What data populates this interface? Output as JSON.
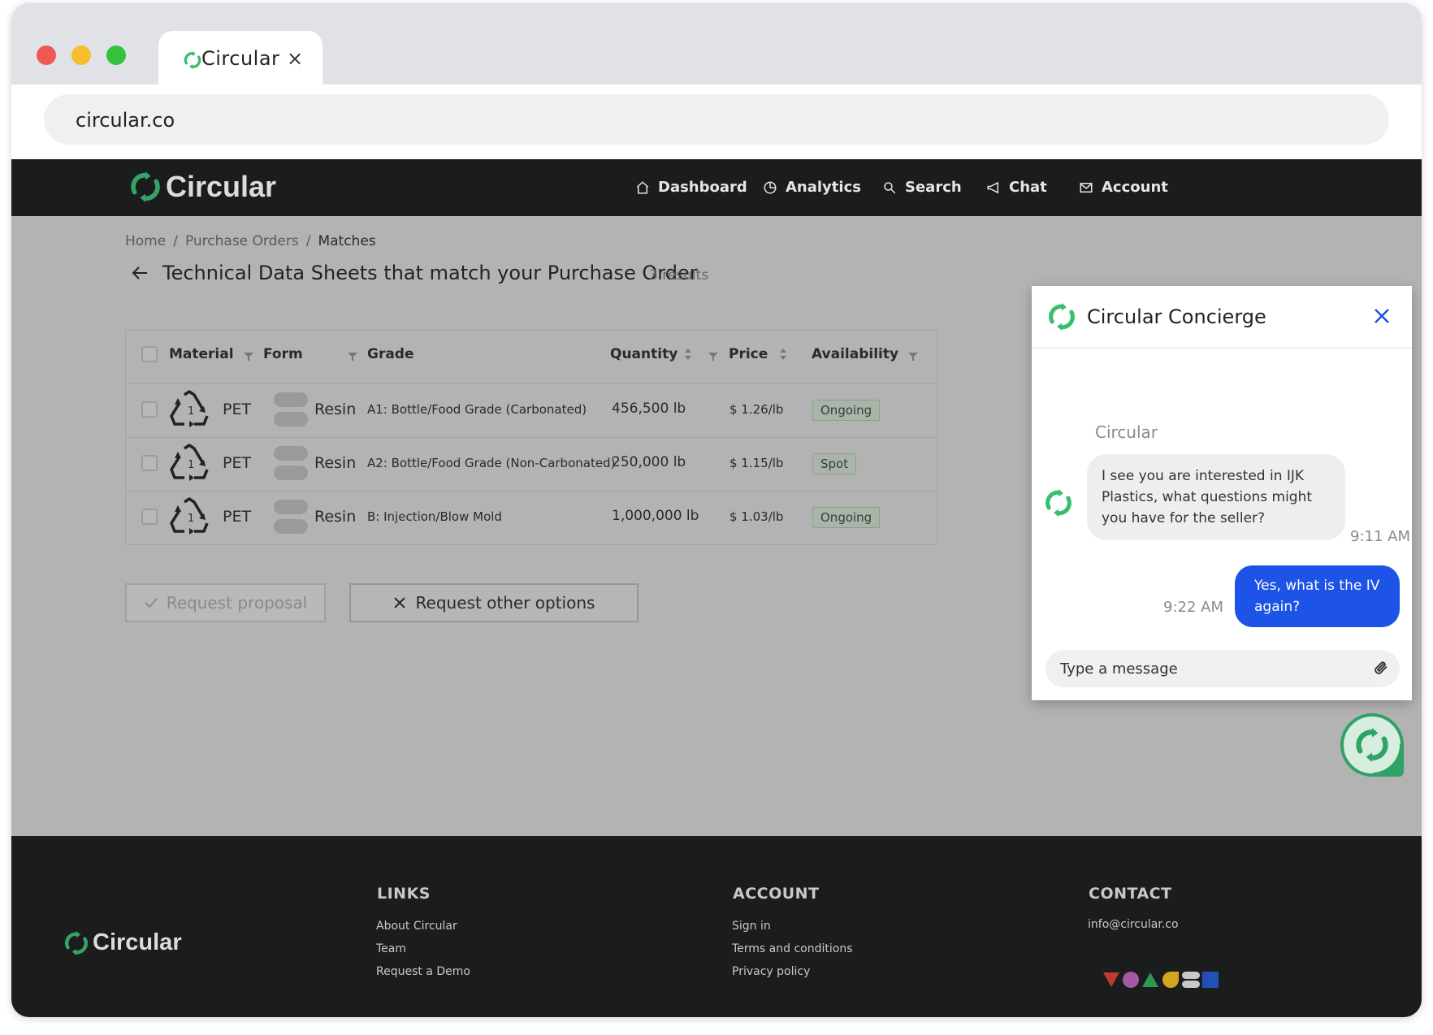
{
  "browser": {
    "tab_title": "Circular",
    "tab_close": "×",
    "url": "circular.co"
  },
  "header": {
    "brand": "Circular",
    "nav": [
      {
        "label": "Dashboard",
        "icon": "home-icon"
      },
      {
        "label": "Analytics",
        "icon": "pie-chart-icon"
      },
      {
        "label": "Search",
        "icon": "search-icon"
      },
      {
        "label": "Chat",
        "icon": "megaphone-icon"
      },
      {
        "label": "Account",
        "icon": "mail-icon"
      }
    ]
  },
  "breadcrumb": {
    "home": "Home",
    "sep": "/",
    "purchase_orders": "Purchase Orders",
    "current": "Matches"
  },
  "main": {
    "title": "Technical Data Sheets that match your Purchase Order",
    "results": "3 results"
  },
  "table": {
    "headers": {
      "material": "Material",
      "form": "Form",
      "grade": "Grade",
      "quantity": "Quantity",
      "price": "Price",
      "availability": "Availability"
    },
    "rows": [
      {
        "material_code": "1",
        "material": "PET",
        "form": "Resin",
        "grade": "A1: Bottle/Food Grade (Carbonated)",
        "quantity": "456,500 lb",
        "price": "$ 1.26/lb",
        "availability": "Ongoing"
      },
      {
        "material_code": "1",
        "material": "PET",
        "form": "Resin",
        "grade": "A2: Bottle/Food Grade (Non-Carbonated)",
        "quantity": "250,000 lb",
        "price": "$ 1.15/lb",
        "availability": "Spot"
      },
      {
        "material_code": "1",
        "material": "PET",
        "form": "Resin",
        "grade": "B: Injection/Blow Mold",
        "quantity": "1,000,000 lb",
        "price": "$ 1.03/lb",
        "availability": "Ongoing"
      }
    ]
  },
  "actions": {
    "request_proposal": "Request proposal",
    "request_other": "Request other options"
  },
  "chat": {
    "title": "Circular Concierge",
    "sender": "Circular",
    "incoming": "I see you are interested in IJK Plastics, what questions might you have for the seller?",
    "incoming_time": "9:11 AM",
    "outgoing": "Yes, what is the IV again?",
    "outgoing_time": "9:22 AM",
    "input_placeholder": "Type a message"
  },
  "footer": {
    "brand": "Circular",
    "links_heading": "LINKS",
    "links": [
      "About Circular",
      "Team",
      "Request a Demo"
    ],
    "account_heading": "ACCOUNT",
    "account_links": [
      "Sign in",
      "Terms and conditions",
      "Privacy policy"
    ],
    "contact_heading": "CONTACT",
    "email": "info@circular.co"
  },
  "colors": {
    "brand_green": "#2fa266",
    "chat_blue": "#1d53e6",
    "header_bg": "#1b1c1c"
  }
}
